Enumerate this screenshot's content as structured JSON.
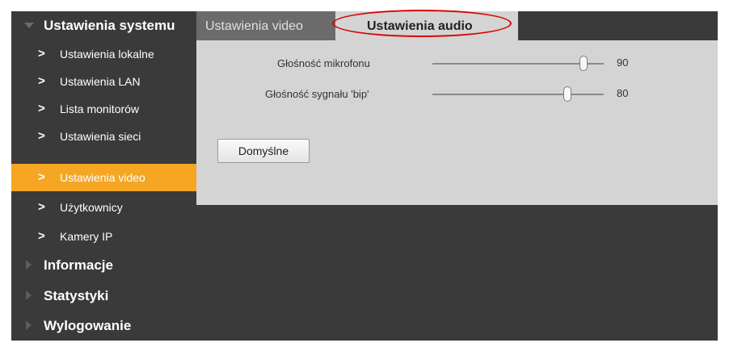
{
  "sidebar": {
    "sections": [
      {
        "label": "Ustawienia systemu",
        "arrow_icon": "triangle-down",
        "expanded": true
      },
      {
        "label": "Informacje",
        "arrow_icon": "triangle-right",
        "expanded": false
      },
      {
        "label": "Statystyki",
        "arrow_icon": "triangle-right",
        "expanded": false
      },
      {
        "label": "Wylogowanie",
        "arrow_icon": "triangle-right",
        "expanded": false
      }
    ],
    "items": [
      {
        "label": "Ustawienia lokalne",
        "chevron": ">"
      },
      {
        "label": "Ustawienia LAN",
        "chevron": ">"
      },
      {
        "label": "Lista monitorów",
        "chevron": ">"
      },
      {
        "label": "Ustawienia sieci",
        "chevron": ">"
      },
      {
        "label": "Ustawienia video",
        "chevron": ">",
        "active": true
      },
      {
        "label": "Użytkownicy",
        "chevron": ">"
      },
      {
        "label": "Kamery IP",
        "chevron": ">"
      }
    ]
  },
  "tabs": [
    {
      "label": "Ustawienia video",
      "selected": false
    },
    {
      "label": "Ustawienia audio",
      "selected": true,
      "highlighted": true
    }
  ],
  "audio": {
    "mic_label": "Głośność mikrofonu",
    "mic_value": "90",
    "mic_level": 90,
    "beep_label": "Głośność sygnału 'bip'",
    "beep_value": "80",
    "beep_level": 80
  },
  "buttons": {
    "default_label": "Domyślne"
  },
  "colors": {
    "background": "#3a3a3a",
    "panel": "#d4d4d4",
    "active_item": "#f5a623",
    "inactive_tab": "#6b6b6b",
    "highlight_ring": "#d90000"
  }
}
